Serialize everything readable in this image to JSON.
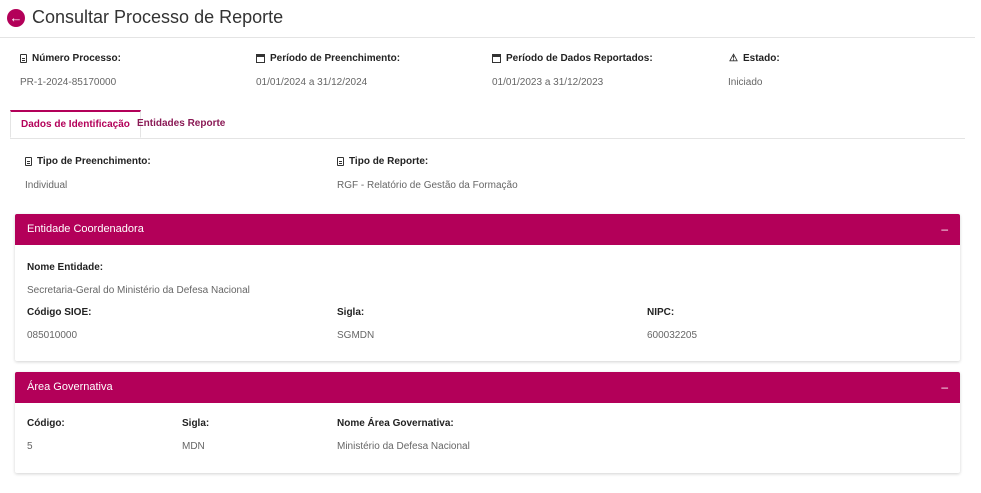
{
  "header": {
    "title": "Consultar Processo de Reporte",
    "back_icon": "arrow-left-icon"
  },
  "summary": {
    "numero": {
      "label": "Número Processo:",
      "value": "PR-1-2024-85170000"
    },
    "periodo_preenchimento": {
      "label": "Período de Preenchimento:",
      "value": "01/01/2024 a 31/12/2024"
    },
    "periodo_dados": {
      "label": "Período de Dados Reportados:",
      "value": "01/01/2023 a 31/12/2023"
    },
    "estado": {
      "label": "Estado:",
      "value": "Iniciado"
    }
  },
  "tabs": [
    {
      "label": "Dados de Identificação",
      "active": true
    },
    {
      "label": "Entidades Reporte",
      "active": false
    }
  ],
  "identificacao": {
    "tipo_preenchimento": {
      "label": "Tipo de Preenchimento:",
      "value": "Individual"
    },
    "tipo_reporte": {
      "label": "Tipo de Reporte:",
      "value": "RGF - Relatório de Gestão da Formação"
    }
  },
  "entidade": {
    "title": "Entidade Coordenadora",
    "collapse_symbol": "–",
    "nome": {
      "label": "Nome Entidade:",
      "value": "Secretaria-Geral do Ministério da Defesa Nacional"
    },
    "codigo": {
      "label": "Código SIOE:",
      "value": "085010000"
    },
    "sigla": {
      "label": "Sigla:",
      "value": "SGMDN"
    },
    "nipc": {
      "label": "NIPC:",
      "value": "600032205"
    }
  },
  "area": {
    "title": "Área Governativa",
    "collapse_symbol": "–",
    "codigo": {
      "label": "Código:",
      "value": "5"
    },
    "sigla": {
      "label": "Sigla:",
      "value": "MDN"
    },
    "nome": {
      "label": "Nome Área Governativa:",
      "value": "Ministério da Defesa Nacional"
    }
  },
  "colors": {
    "accent": "#b30059",
    "tab_text": "#8a1a55"
  }
}
